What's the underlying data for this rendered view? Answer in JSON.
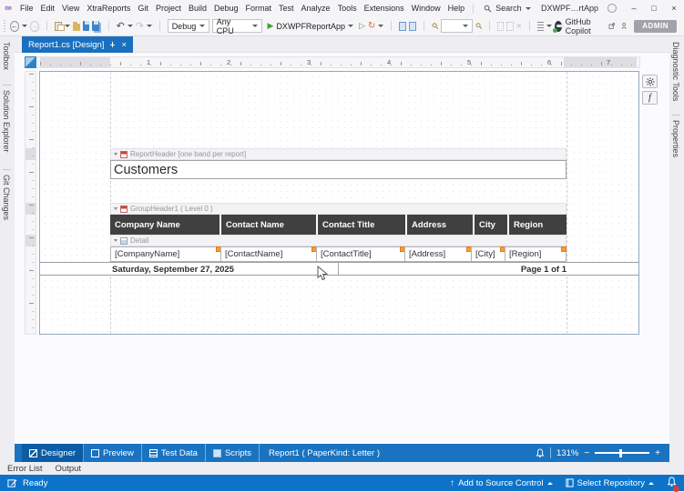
{
  "menu": {
    "items": [
      "File",
      "Edit",
      "View",
      "XtraReports",
      "Git",
      "Project",
      "Build",
      "Debug",
      "Format",
      "Test",
      "Analyze",
      "Tools",
      "Extensions",
      "Window",
      "Help"
    ]
  },
  "titlebar": {
    "search": "Search",
    "app": "DXWPF…rtApp"
  },
  "toolbar": {
    "debug": "Debug",
    "cpu": "Any CPU",
    "run": "DXWPFReportApp",
    "copilot": "GitHub Copilot",
    "admin": "ADMIN"
  },
  "tab": {
    "title": "Report1.cs [Design]"
  },
  "left_tabs": [
    "Toolbox",
    "Solution Explorer",
    "Git Changes"
  ],
  "right_tabs": [
    "Diagnostic Tools",
    "Properties"
  ],
  "ruler": {
    "numbers": [
      "1",
      "2",
      "3",
      "4",
      "5",
      "6",
      "7"
    ]
  },
  "report": {
    "band_report_header": "ReportHeader [one band per report]",
    "band_group_header": "GroupHeader1 ( Level 0 )",
    "band_detail": "Detail",
    "title": "Customers",
    "headers": [
      "Company Name",
      "Contact Name",
      "Contact Title",
      "Address",
      "City",
      "Region"
    ],
    "fields": [
      "[CompanyName]",
      "[ContactName]",
      "[ContactTitle]",
      "[Address]",
      "[City]",
      "[Region]"
    ],
    "date": "Saturday, September 27, 2025",
    "page_info": "Page 1 of 1"
  },
  "bottom": {
    "tabs": [
      "Designer",
      "Preview",
      "Test Data",
      "Scripts"
    ],
    "info": "Report1 ( PaperKind: Letter )",
    "zoom": "131%",
    "minus": "−",
    "plus": "+"
  },
  "panels": [
    "Error List",
    "Output"
  ],
  "status": {
    "ready": "Ready",
    "add": "Add to Source Control",
    "repo": "Select Repository"
  },
  "icons": {
    "infinity": "∞",
    "back": "←",
    "forward": "→",
    "undo": "↶",
    "redo": "↷",
    "play": "▶",
    "play_outline": "▷",
    "hot_reload": "↻",
    "close": "×",
    "min": "–",
    "max": "□",
    "fx": "f",
    "up_arrow": "↑",
    "cancel": "×"
  },
  "colors": {
    "accent": "#1a73c0",
    "status_bar": "#0d73c9",
    "header_cell": "#404040",
    "smart_tag": "#ff9a2e",
    "active_tab": "#1a6fbf"
  }
}
